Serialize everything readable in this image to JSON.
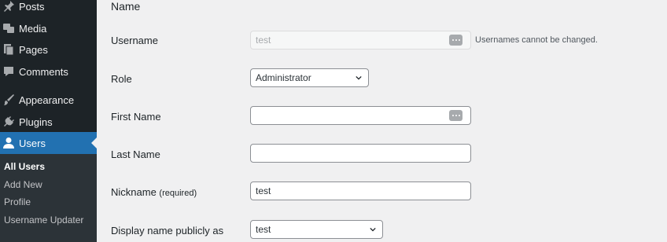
{
  "sidebar": {
    "items": [
      {
        "label": "Posts",
        "icon": "pin-icon"
      },
      {
        "label": "Media",
        "icon": "media-icon"
      },
      {
        "label": "Pages",
        "icon": "pages-icon"
      },
      {
        "label": "Comments",
        "icon": "comment-icon"
      },
      {
        "label": "Appearance",
        "icon": "brush-icon"
      },
      {
        "label": "Plugins",
        "icon": "plug-icon"
      },
      {
        "label": "Users",
        "icon": "user-icon",
        "active": true
      }
    ],
    "submenu": [
      "All Users",
      "Add New",
      "Profile",
      "Username Updater"
    ]
  },
  "main": {
    "section_title": "Name",
    "username": {
      "label": "Username",
      "value": "test",
      "note": "Usernames cannot be changed."
    },
    "role": {
      "label": "Role",
      "value": "Administrator"
    },
    "first_name": {
      "label": "First Name",
      "value": ""
    },
    "last_name": {
      "label": "Last Name",
      "value": ""
    },
    "nickname": {
      "label": "Nickname",
      "required": "(required)",
      "value": "test"
    },
    "display_name": {
      "label": "Display name publicly as",
      "value": "test"
    }
  },
  "colors": {
    "sidebar_bg": "#1d2327",
    "accent": "#2271b1",
    "page_bg": "#f0f0f1"
  }
}
